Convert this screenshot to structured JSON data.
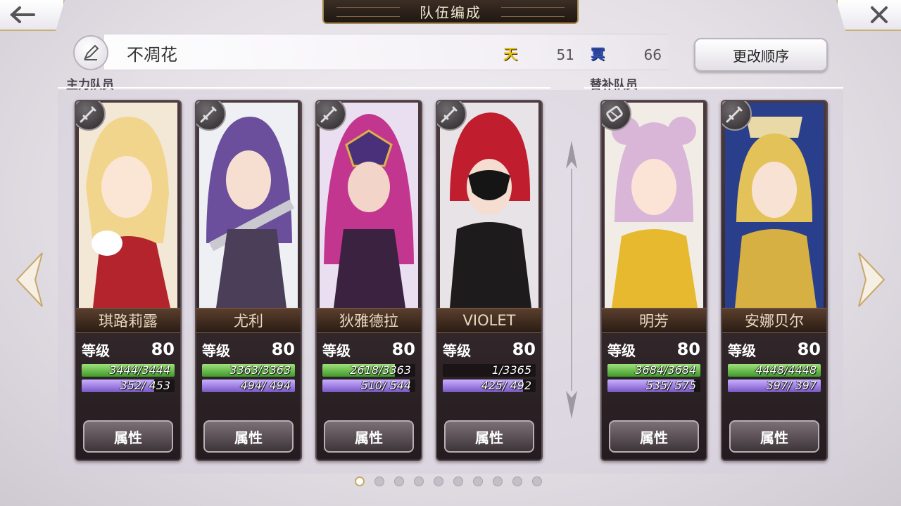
{
  "header": {
    "title": "队伍编成",
    "back_icon": "back-arrow-icon",
    "close_icon": "close-icon"
  },
  "team": {
    "name": "不凋花",
    "sky_badge": "天",
    "sky_value": "51",
    "hell_badge": "冥",
    "hell_value": "66",
    "reorder_label": "更改顺序"
  },
  "sections": {
    "main_label": "主力队员",
    "sub_label": "替补队员"
  },
  "common": {
    "level_label": "等级",
    "attr_label": "属性"
  },
  "main_members": [
    {
      "name": "琪路莉露",
      "level": "80",
      "hp": "3444/3444",
      "hp_ratio": 1.0,
      "mp": "352/ 453",
      "mp_ratio": 0.78,
      "weapon": "sword-icon"
    },
    {
      "name": "尤利",
      "level": "80",
      "hp": "3363/3363",
      "hp_ratio": 1.0,
      "mp": "494/ 494",
      "mp_ratio": 1.0,
      "weapon": "sword-icon"
    },
    {
      "name": "狄雅德拉",
      "level": "80",
      "hp": "2618/3363",
      "hp_ratio": 0.78,
      "mp": "510/ 544",
      "mp_ratio": 0.94,
      "weapon": "sword-icon"
    },
    {
      "name": "VIOLET",
      "level": "80",
      "hp": "1/3365",
      "hp_ratio": 0.0,
      "mp": "425/ 492",
      "mp_ratio": 0.86,
      "weapon": "sword-icon"
    }
  ],
  "sub_members": [
    {
      "name": "明芳",
      "level": "80",
      "hp": "3684/3684",
      "hp_ratio": 1.0,
      "mp": "535/ 575",
      "mp_ratio": 0.93,
      "weapon": "gauntlet-icon"
    },
    {
      "name": "安娜贝尔",
      "level": "80",
      "hp": "4448/4448",
      "hp_ratio": 1.0,
      "mp": "397/ 397",
      "mp_ratio": 1.0,
      "weapon": "sword-icon"
    }
  ],
  "pagination": {
    "total": 10,
    "current": 1
  },
  "colors": {
    "accent_gold": "#c9a86a",
    "hp_green": "#3f9a2a",
    "mp_purple": "#7a58c6"
  }
}
